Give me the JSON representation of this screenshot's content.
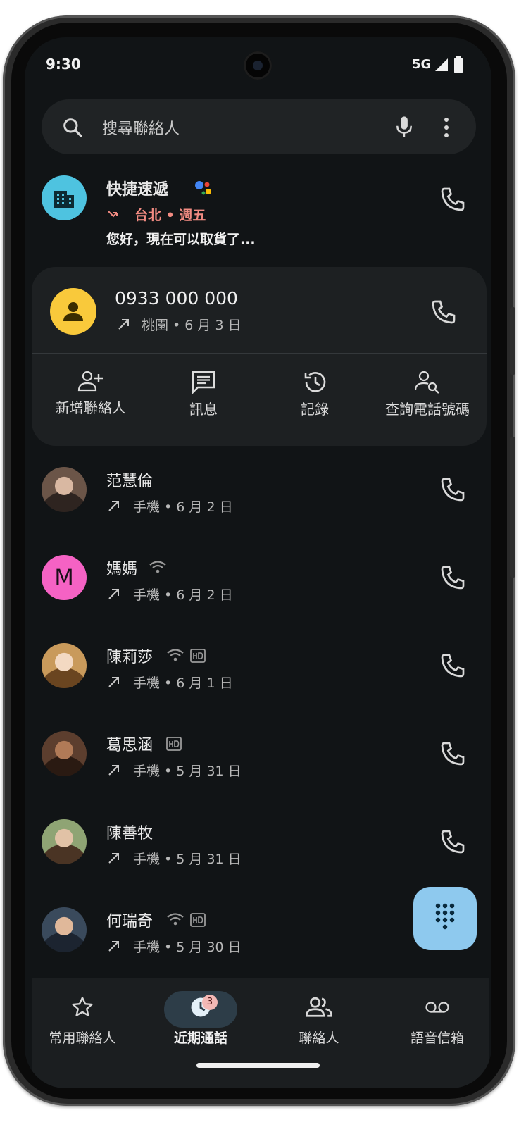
{
  "status_bar": {
    "time": "9:30",
    "network": "5G"
  },
  "search": {
    "placeholder": "搜尋聯絡人"
  },
  "business_call": {
    "name": "快捷速遞",
    "detail": "台北 • 週五",
    "snippet": "您好，現在可以取貨了...",
    "avatar_color": "#4ec3e0",
    "detail_color": "#f28b82"
  },
  "expanded_call": {
    "number": "0933 000 000",
    "detail": "桃園 • 6 月 3 日",
    "avatar_color": "#f9c93b",
    "actions": [
      {
        "icon": "add-person-icon",
        "label": "新增聯絡人"
      },
      {
        "icon": "message-icon",
        "label": "訊息"
      },
      {
        "icon": "history-icon",
        "label": "記錄"
      },
      {
        "icon": "person-search-icon",
        "label": "查詢電話號碼"
      }
    ]
  },
  "calls": [
    {
      "name": "范慧倫",
      "detail": "手機 • 6 月 2 日",
      "wifi": false,
      "hd": false,
      "avatar": "photo"
    },
    {
      "name": "媽媽",
      "detail": "手機 • 6 月 2 日",
      "wifi": true,
      "hd": false,
      "avatar": "M",
      "avatar_color": "#f562c4"
    },
    {
      "name": "陳莉莎",
      "detail": "手機 • 6 月 1 日",
      "wifi": true,
      "hd": true,
      "avatar": "photo"
    },
    {
      "name": "葛思涵",
      "detail": "手機 • 5 月 31 日",
      "wifi": false,
      "hd": true,
      "avatar": "photo"
    },
    {
      "name": "陳善牧",
      "detail": "手機 • 5 月 31 日",
      "wifi": false,
      "hd": false,
      "avatar": "photo"
    },
    {
      "name": "何瑞奇",
      "detail": "手機 • 5 月 30 日",
      "wifi": true,
      "hd": true,
      "avatar": "photo"
    }
  ],
  "bottom_nav": {
    "items": [
      {
        "icon": "star-icon",
        "label": "常用聯絡人"
      },
      {
        "icon": "recent-calls-icon",
        "label": "近期通話",
        "badge": "3",
        "active": true
      },
      {
        "icon": "contacts-icon",
        "label": "聯絡人"
      },
      {
        "icon": "voicemail-icon",
        "label": "語音信箱"
      }
    ]
  }
}
